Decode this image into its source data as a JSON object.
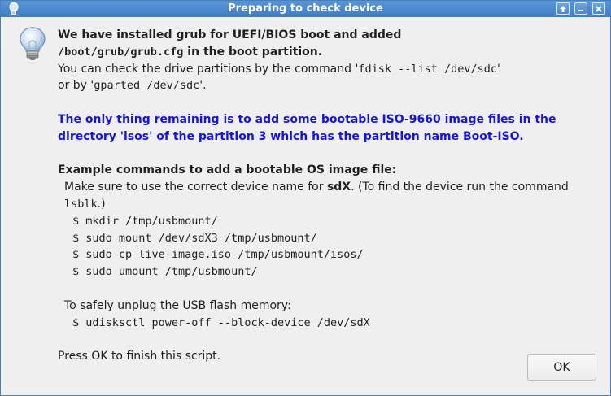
{
  "window": {
    "title": "Preparing to check device",
    "colors": {
      "titlebar": "#4a88cf",
      "background": "#efefef",
      "highlight_text": "#1515e0"
    },
    "controls": [
      "up-arrow-icon",
      "minimize-icon",
      "close-icon"
    ]
  },
  "message": {
    "line1": "We have installed grub for UEFI/BIOS boot and added",
    "line2_code": "/boot/grub/grub.cfg",
    "line2_rest": " in the boot partition.",
    "line3_prefix": "You can check the drive partitions by the command '",
    "line3_code": "fdisk --list /dev/sdc",
    "line3_suffix": "'",
    "line4_prefix": "or by '",
    "line4_code": "gparted /dev/sdc",
    "line4_suffix": "'.",
    "highlight_line1": "The only thing remaining is to add some bootable ISO-9660 image files in the",
    "highlight_line2": "directory 'isos' of the partition 3 which has the partition name Boot-ISO.",
    "example_heading": "Example commands to add a bootable OS image file:",
    "note_prefix": "Make sure to use the correct device name for ",
    "note_device": "sdX",
    "note_middle": ". (To find the device run the command ",
    "note_cmd": "lsblk",
    "note_suffix": ".)",
    "commands": [
      "$ mkdir /tmp/usbmount/",
      "$ sudo mount /dev/sdX3 /tmp/usbmount/",
      "$ sudo cp live-image.iso /tmp/usbmount/isos/",
      "$ sudo umount /tmp/usbmount/"
    ],
    "unplug_heading": "To safely unplug the USB flash memory:",
    "unplug_command": "$ udisksctl power-off --block-device /dev/sdX",
    "finish": "Press OK to finish this script."
  },
  "buttons": {
    "ok_label": "OK"
  },
  "icons": {
    "title": "lightbulb-icon",
    "body": "lightbulb-icon"
  }
}
